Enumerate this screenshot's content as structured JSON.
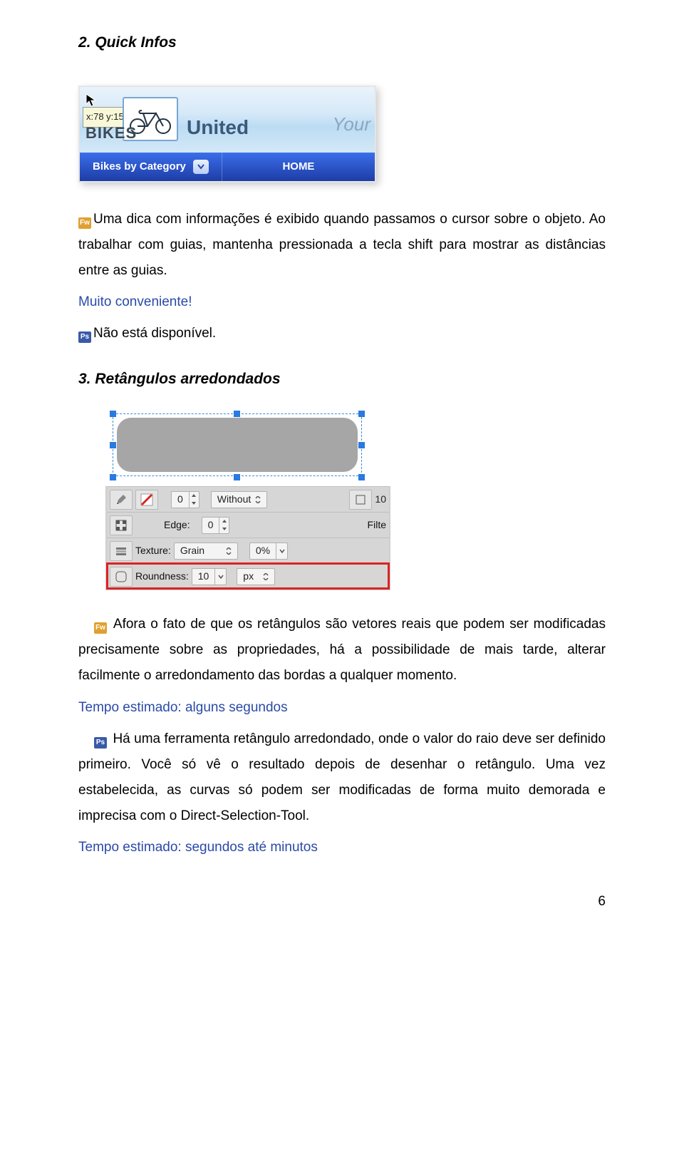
{
  "headings": {
    "h2": "2. Quick Infos",
    "h3": "3. Retângulos arredondados"
  },
  "shot1": {
    "coord": "x:78 y:15",
    "bikes": "BIKES",
    "united": "United",
    "your": "Your",
    "nav_category": "Bikes by Category",
    "nav_home": "HOME"
  },
  "para1": {
    "fw": "Fw",
    "text": "Uma dica com informações é exibido quando passamos o cursor sobre o objeto. Ao trabalhar com guias, mantenha pressionada a tecla shift para mostrar as distâncias entre as guias.",
    "conv": "Muito conveniente!",
    "ps": "Ps",
    "ps_text": "Não está disponível."
  },
  "panel": {
    "without": "Without",
    "ten_a": "10",
    "edge_lbl": "Edge:",
    "edge_val": "0",
    "filte": "Filte",
    "texture_lbl": "Texture:",
    "texture_val": "Grain",
    "texture_pct": "0%",
    "roundness_lbl": "Roundness:",
    "roundness_val": "10",
    "roundness_unit": "px"
  },
  "para2": {
    "fw": "Fw",
    "text": "Afora o fato de que os retângulos são vetores reais que podem ser modificadas precisamente sobre as propriedades, há a possibilidade de mais tarde, alterar facilmente o arredondamento das bordas a qualquer momento.",
    "tempo1": "Tempo estimado: alguns segundos",
    "ps": "Ps",
    "ps_text": "Há uma ferramenta retângulo arredondado, onde o valor do raio deve ser definido primeiro. Você só vê o resultado depois de desenhar o retângulo. Uma vez estabelecida, as curvas só podem ser modificadas de forma muito demorada e imprecisa com o Direct-Selection-Tool.",
    "tempo2": "Tempo estimado: segundos até minutos"
  },
  "page_number": "6"
}
